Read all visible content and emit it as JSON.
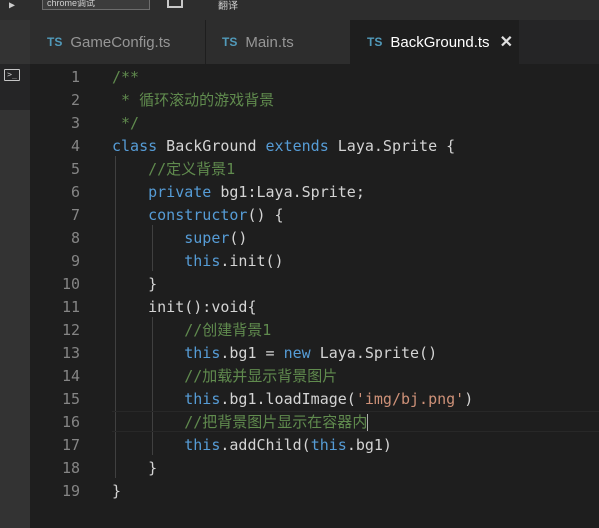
{
  "topbar": {
    "field_value": "chrome调试",
    "label": "翻译"
  },
  "tabs": [
    {
      "badge": "TS",
      "label": "GameConfig.ts",
      "active": false
    },
    {
      "badge": "TS",
      "label": "Main.ts",
      "active": false
    },
    {
      "badge": "TS",
      "label": "BackGround.ts",
      "active": true,
      "close": "✕"
    }
  ],
  "editor": {
    "current_line": 16,
    "lines": [
      {
        "n": "1",
        "tokens": [
          [
            "c",
            "/**"
          ]
        ]
      },
      {
        "n": "2",
        "tokens": [
          [
            "c",
            " * 循环滚动的游戏背景"
          ]
        ]
      },
      {
        "n": "3",
        "tokens": [
          [
            "c",
            " */"
          ]
        ]
      },
      {
        "n": "4",
        "tokens": [
          [
            "k",
            "class"
          ],
          [
            "t",
            " BackGround "
          ],
          [
            "k",
            "extends"
          ],
          [
            "t",
            " Laya.Sprite {"
          ]
        ]
      },
      {
        "n": "5",
        "tokens": [
          [
            "t",
            "    "
          ],
          [
            "c",
            "//定义背景1"
          ]
        ]
      },
      {
        "n": "6",
        "tokens": [
          [
            "t",
            "    "
          ],
          [
            "k",
            "private"
          ],
          [
            "t",
            " bg1:Laya.Sprite;"
          ]
        ]
      },
      {
        "n": "7",
        "tokens": [
          [
            "t",
            "    "
          ],
          [
            "k",
            "constructor"
          ],
          [
            "t",
            "() {"
          ]
        ]
      },
      {
        "n": "8",
        "tokens": [
          [
            "t",
            "        "
          ],
          [
            "k",
            "super"
          ],
          [
            "t",
            "()"
          ]
        ]
      },
      {
        "n": "9",
        "tokens": [
          [
            "t",
            "        "
          ],
          [
            "k",
            "this"
          ],
          [
            "t",
            ".init()"
          ]
        ]
      },
      {
        "n": "10",
        "tokens": [
          [
            "t",
            "    }"
          ]
        ]
      },
      {
        "n": "11",
        "tokens": [
          [
            "t",
            "    init():void{"
          ]
        ]
      },
      {
        "n": "12",
        "tokens": [
          [
            "t",
            "        "
          ],
          [
            "c",
            "//创建背景1"
          ]
        ]
      },
      {
        "n": "13",
        "tokens": [
          [
            "t",
            "        "
          ],
          [
            "k",
            "this"
          ],
          [
            "t",
            ".bg1 = "
          ],
          [
            "k",
            "new"
          ],
          [
            "t",
            " Laya.Sprite()"
          ]
        ]
      },
      {
        "n": "14",
        "tokens": [
          [
            "t",
            "        "
          ],
          [
            "c",
            "//加载并显示背景图片"
          ]
        ]
      },
      {
        "n": "15",
        "tokens": [
          [
            "t",
            "        "
          ],
          [
            "k",
            "this"
          ],
          [
            "t",
            ".bg1.loadImage("
          ],
          [
            "s",
            "'img/bj.png'"
          ],
          [
            "t",
            ")"
          ]
        ]
      },
      {
        "n": "16",
        "tokens": [
          [
            "t",
            "        "
          ],
          [
            "c",
            "//把背景图片显示在容器内"
          ]
        ]
      },
      {
        "n": "17",
        "tokens": [
          [
            "t",
            "        "
          ],
          [
            "k",
            "this"
          ],
          [
            "t",
            ".addChild("
          ],
          [
            "k",
            "this"
          ],
          [
            "t",
            ".bg1)"
          ]
        ]
      },
      {
        "n": "18",
        "tokens": [
          [
            "t",
            "    }"
          ]
        ]
      },
      {
        "n": "19",
        "tokens": [
          [
            "t",
            "}"
          ]
        ]
      }
    ]
  },
  "icons": {
    "activity": "terminal-icon",
    "topbar_toggle": "panel-toggle-icon",
    "run": "play-icon",
    "tab_close": "close-icon"
  },
  "colors": {
    "keyword": "#569cd6",
    "comment": "#608b4e",
    "string": "#ce9178",
    "text": "#d4d4d4",
    "ts_badge": "#519aba"
  }
}
